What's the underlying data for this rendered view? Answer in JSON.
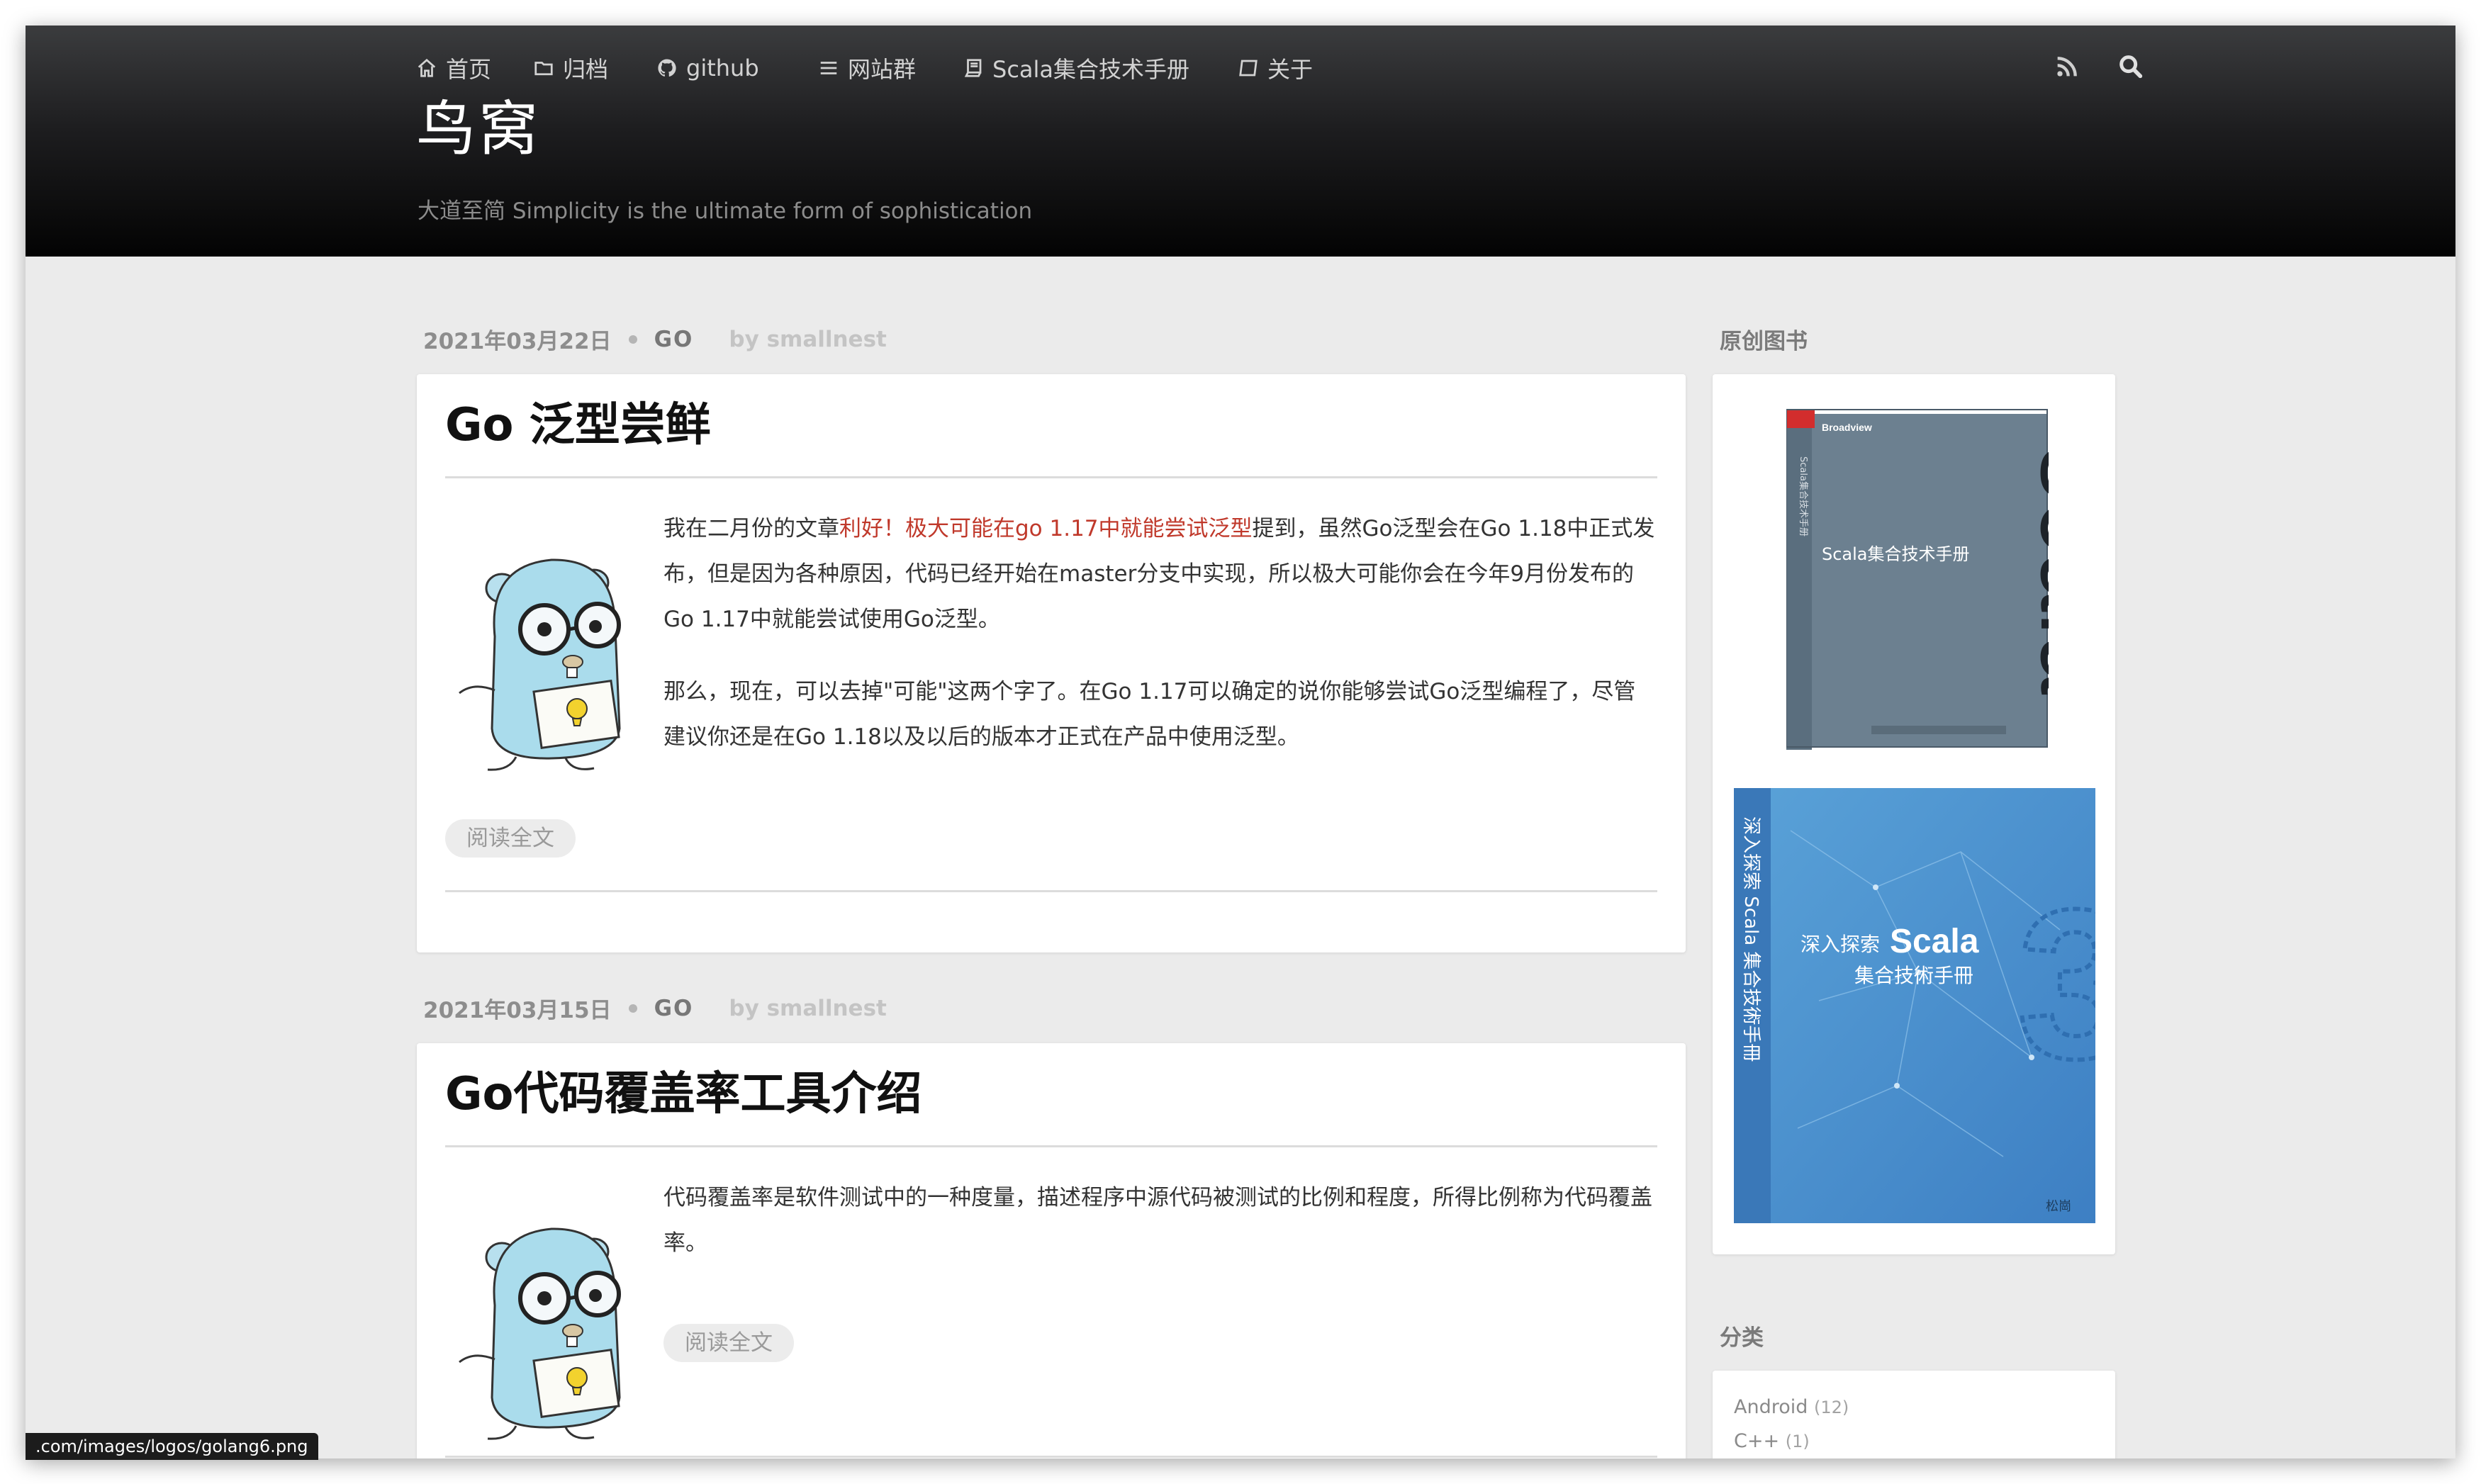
{
  "nav": {
    "items": [
      {
        "label": "首页",
        "icon": "home-icon"
      },
      {
        "label": "归档",
        "icon": "folder-icon"
      },
      {
        "label": "github",
        "icon": "github-icon"
      },
      {
        "label": "网站群",
        "icon": "list-icon"
      },
      {
        "label": "Scala集合技术手册",
        "icon": "book-icon"
      },
      {
        "label": "关于",
        "icon": "comment-icon"
      }
    ],
    "right_icons": [
      "rss-icon",
      "search-icon"
    ]
  },
  "site": {
    "title": "鸟窝",
    "subtitle": "大道至简 Simplicity is the ultimate form of sophistication"
  },
  "posts": [
    {
      "date": "2021年03月22日",
      "category": "GO",
      "author": "by smallnest",
      "title": "Go 泛型尝鲜",
      "p1_before": "我在二月份的文章",
      "p1_link": "利好！极大可能在go 1.17中就能尝试泛型",
      "p1_after": "提到，虽然Go泛型会在Go 1.18中正式发布，但是因为各种原因，代码已经开始在master分支中实现，所以极大可能你会在今年9月份发布的Go 1.17中就能尝试使用Go泛型。",
      "p2": "那么，现在，可以去掉\"可能\"这两个字了。在Go 1.17可以确定的说你能够尝试Go泛型编程了，尽管建议你还是在Go 1.18以及以后的版本才正式在产品中使用泛型。",
      "read_more": "阅读全文"
    },
    {
      "date": "2021年03月15日",
      "category": "GO",
      "author": "by smallnest",
      "title": "Go代码覆盖率工具介绍",
      "p1": "代码覆盖率是软件测试中的一种度量，描述程序中源代码被测试的比例和程度，所得比例称为代码覆盖率。",
      "read_more": "阅读全文"
    }
  ],
  "sidebar": {
    "books_heading": "原创图书",
    "book1": {
      "publisher": "Broadview",
      "title": "Scala集合技术手册",
      "spine": "Scala集合技术手册",
      "big": "scala"
    },
    "book2": {
      "spine": "深入探索 Scala 集合技術手冊",
      "title_line1": "深入探索",
      "title_big": "Scala",
      "title_line2": "集合技術手冊",
      "publisher": "松崗"
    },
    "categories_heading": "分类",
    "categories": [
      {
        "name": "Android",
        "count": "(12)"
      },
      {
        "name": "C++",
        "count": "(1)"
      }
    ]
  },
  "status_bar": {
    "url": ".com/images/logos/golang6.png"
  },
  "colors": {
    "link": "#c0392b",
    "header_dark": "#030303",
    "page_bg": "#ebebeb"
  }
}
